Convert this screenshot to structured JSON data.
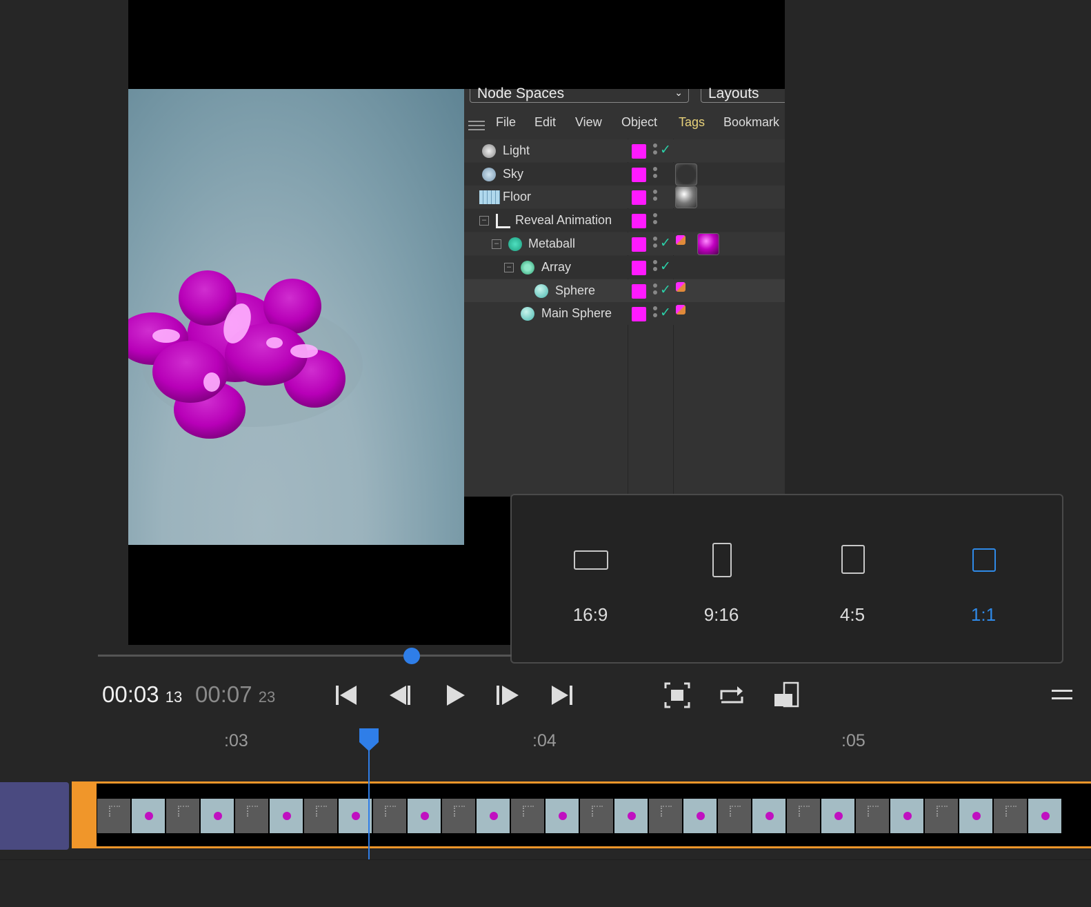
{
  "c4d": {
    "node_spaces": "Node Spaces",
    "layouts": "Layouts",
    "menu": [
      "File",
      "Edit",
      "View",
      "Object",
      "Tags",
      "Bookmark"
    ],
    "objects": [
      {
        "name": "Light",
        "icon": "light-icon"
      },
      {
        "name": "Sky",
        "icon": "sky-icon"
      },
      {
        "name": "Floor",
        "icon": "floor-icon"
      },
      {
        "name": "Reveal Animation",
        "icon": "null-object-icon"
      },
      {
        "name": "Metaball",
        "icon": "metaball-icon"
      },
      {
        "name": "Array",
        "icon": "array-icon"
      },
      {
        "name": "Sphere",
        "icon": "sphere-icon"
      },
      {
        "name": "Main Sphere",
        "icon": "sphere-icon"
      }
    ]
  },
  "aspect_ratios": {
    "options": [
      "16:9",
      "9:16",
      "4:5",
      "1:1"
    ],
    "selected": "1:1",
    "accent_color": "#2f8ae8"
  },
  "playback": {
    "current_time": "00:03",
    "current_frame": "13",
    "duration": "00:07",
    "duration_frame": "23",
    "scrub_fraction": 0.46
  },
  "timeline": {
    "ticks": [
      ":03",
      ":04",
      ":05"
    ],
    "clip_color": "#f0962a"
  }
}
